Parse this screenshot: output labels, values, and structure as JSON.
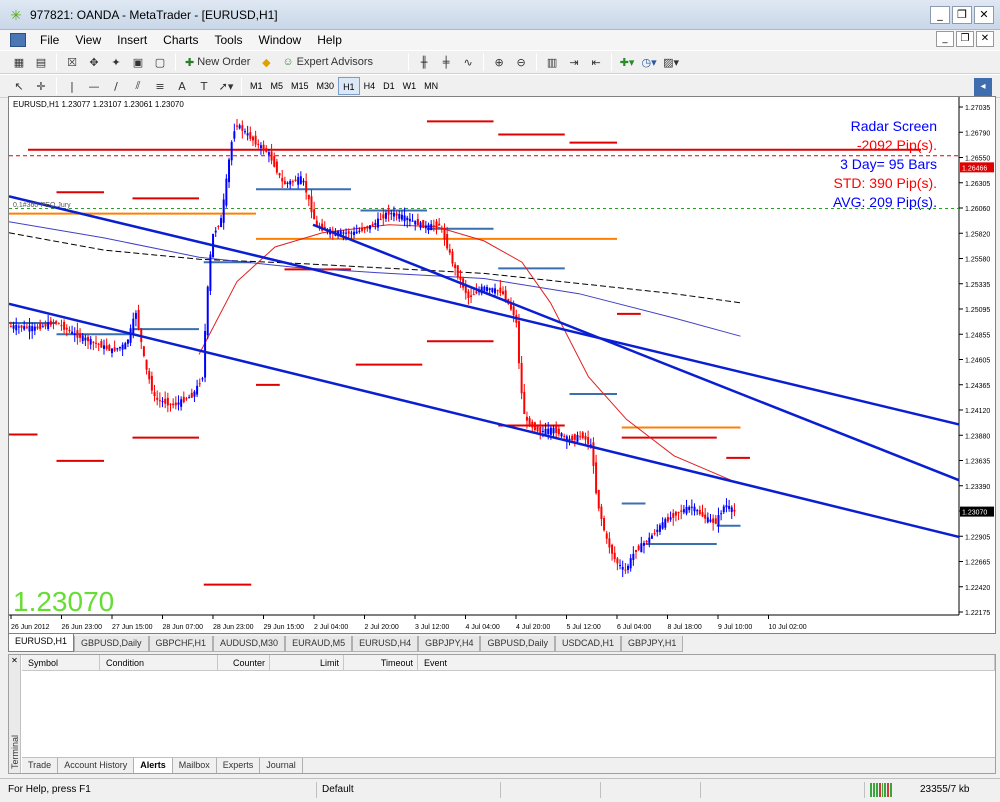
{
  "window": {
    "title": "977821: OANDA - MetaTrader - [EURUSD,H1]",
    "icon": "meta-trader-icon"
  },
  "menu": [
    "File",
    "View",
    "Insert",
    "Charts",
    "Tools",
    "Window",
    "Help"
  ],
  "toolbar": {
    "new_order": "New Order",
    "expert_advisors": "Expert Advisors",
    "timeframes": [
      "M1",
      "M5",
      "M15",
      "M30",
      "H1",
      "H4",
      "D1",
      "W1",
      "MN"
    ],
    "active_timeframe": "H1"
  },
  "chart": {
    "header": "EURUSD,H1  1.23077 1.23107 1.23061 1.23070",
    "indicator_label": "0,1#360-PEO Jury",
    "big_price": "1.23070",
    "current_price": "1.23070",
    "red_line_price": "1.26466",
    "radar": {
      "title": "Radar Screen",
      "pips": "-2092 Pip(s).",
      "bars": "3 Day= 95 Bars",
      "std": "STD: 390 Pip(s).",
      "avg": "AVG: 209 Pip(s)."
    },
    "colors": {
      "radar_blue": "#0000ff",
      "radar_red": "#ff0000",
      "price_green": "#66dd33",
      "bull_candle": "#0000ff",
      "bear_candle": "#ff0000"
    }
  },
  "chart_data": {
    "type": "candlestick",
    "symbol": "EURUSD",
    "timeframe": "H1",
    "y_ticks": [
      "1.27035",
      "1.26790",
      "1.26550",
      "1.26305",
      "1.26060",
      "1.25820",
      "1.25580",
      "1.25335",
      "1.25095",
      "1.24855",
      "1.24605",
      "1.24365",
      "1.24120",
      "1.23880",
      "1.23635",
      "1.23390",
      "1.23150",
      "1.22905",
      "1.22665",
      "1.22420",
      "1.22175"
    ],
    "x_ticks": [
      "26 Jun 2012",
      "26 Jun 23:00",
      "27 Jun 15:00",
      "28 Jun 07:00",
      "28 Jun 23:00",
      "29 Jun 15:00",
      "2 Jul 04:00",
      "2 Jul 20:00",
      "3 Jul 12:00",
      "4 Jul 04:00",
      "4 Jul 20:00",
      "5 Jul 12:00",
      "6 Jul 04:00",
      "8 Jul 18:00",
      "9 Jul 10:00",
      "10 Jul 02:00"
    ],
    "ylim": [
      1.2205,
      1.2716
    ],
    "price_path": [
      [
        0,
        1.249
      ],
      [
        0.03,
        1.2488
      ],
      [
        0.05,
        1.2494
      ],
      [
        0.07,
        1.2482
      ],
      [
        0.09,
        1.2474
      ],
      [
        0.11,
        1.2466
      ],
      [
        0.125,
        1.2472
      ],
      [
        0.135,
        1.2504
      ],
      [
        0.145,
        1.245
      ],
      [
        0.155,
        1.2418
      ],
      [
        0.175,
        1.2412
      ],
      [
        0.195,
        1.2422
      ],
      [
        0.205,
        1.244
      ],
      [
        0.21,
        1.252
      ],
      [
        0.215,
        1.2578
      ],
      [
        0.225,
        1.2596
      ],
      [
        0.235,
        1.2668
      ],
      [
        0.24,
        1.269
      ],
      [
        0.26,
        1.2672
      ],
      [
        0.275,
        1.266
      ],
      [
        0.29,
        1.263
      ],
      [
        0.31,
        1.2636
      ],
      [
        0.325,
        1.2588
      ],
      [
        0.345,
        1.2582
      ],
      [
        0.365,
        1.2582
      ],
      [
        0.385,
        1.259
      ],
      [
        0.4,
        1.2602
      ],
      [
        0.415,
        1.2598
      ],
      [
        0.44,
        1.2588
      ],
      [
        0.455,
        1.259
      ],
      [
        0.47,
        1.2548
      ],
      [
        0.485,
        1.2518
      ],
      [
        0.5,
        1.2528
      ],
      [
        0.52,
        1.2524
      ],
      [
        0.535,
        1.2498
      ],
      [
        0.54,
        1.243
      ],
      [
        0.545,
        1.2396
      ],
      [
        0.56,
        1.2386
      ],
      [
        0.575,
        1.2388
      ],
      [
        0.59,
        1.2378
      ],
      [
        0.605,
        1.2382
      ],
      [
        0.615,
        1.237
      ],
      [
        0.62,
        1.232
      ],
      [
        0.63,
        1.228
      ],
      [
        0.64,
        1.2258
      ],
      [
        0.65,
        1.2248
      ],
      [
        0.66,
        1.2268
      ],
      [
        0.675,
        1.228
      ],
      [
        0.69,
        1.2296
      ],
      [
        0.705,
        1.2306
      ],
      [
        0.72,
        1.2312
      ],
      [
        0.735,
        1.23
      ],
      [
        0.745,
        1.2296
      ],
      [
        0.755,
        1.2314
      ],
      [
        0.765,
        1.2307
      ]
    ],
    "levels": [
      {
        "color": "#e00000",
        "price": 1.2664,
        "x": [
          0.02,
          0.96
        ]
      },
      {
        "color": "#ff7f00",
        "price": 1.2601,
        "x": [
          0.0,
          0.26
        ]
      },
      {
        "color": "#ff7f00",
        "price": 1.2576,
        "x": [
          0.26,
          0.64
        ]
      },
      {
        "color": "#ff7f00",
        "price": 1.239,
        "x": [
          0.645,
          0.77
        ]
      },
      {
        "color": "#e00000",
        "price": 1.2692,
        "x": [
          0.44,
          0.51
        ]
      },
      {
        "color": "#e00000",
        "price": 1.2679,
        "x": [
          0.515,
          0.585
        ]
      },
      {
        "color": "#e00000",
        "price": 1.2671,
        "x": [
          0.59,
          0.64
        ]
      },
      {
        "color": "#e00000",
        "price": 1.2622,
        "x": [
          0.05,
          0.1
        ]
      },
      {
        "color": "#e00000",
        "price": 1.2616,
        "x": [
          0.13,
          0.2
        ]
      },
      {
        "color": "#e00000",
        "price": 1.2546,
        "x": [
          0.29,
          0.36
        ]
      },
      {
        "color": "#e00000",
        "price": 1.2502,
        "x": [
          0.64,
          0.665
        ]
      },
      {
        "color": "#e00000",
        "price": 1.2475,
        "x": [
          0.44,
          0.51
        ]
      },
      {
        "color": "#e00000",
        "price": 1.2452,
        "x": [
          0.365,
          0.435
        ]
      },
      {
        "color": "#e00000",
        "price": 1.2432,
        "x": [
          0.26,
          0.285
        ]
      },
      {
        "color": "#e00000",
        "price": 1.2392,
        "x": [
          0.515,
          0.585
        ]
      },
      {
        "color": "#e00000",
        "price": 1.238,
        "x": [
          0.645,
          0.745
        ]
      },
      {
        "color": "#e00000",
        "price": 1.2383,
        "x": [
          0.0,
          0.03
        ]
      },
      {
        "color": "#e00000",
        "price": 1.238,
        "x": [
          0.13,
          0.2
        ]
      },
      {
        "color": "#e00000",
        "price": 1.236,
        "x": [
          0.755,
          0.78
        ]
      },
      {
        "color": "#e00000",
        "price": 1.2357,
        "x": [
          0.05,
          0.1
        ]
      },
      {
        "color": "#e00000",
        "price": 1.2235,
        "x": [
          0.205,
          0.255
        ]
      },
      {
        "color": "#3a6fb0",
        "price": 1.2625,
        "x": [
          0.26,
          0.36
        ]
      },
      {
        "color": "#3a6fb0",
        "price": 1.2604,
        "x": [
          0.37,
          0.44
        ]
      },
      {
        "color": "#3a6fb0",
        "price": 1.2586,
        "x": [
          0.44,
          0.51
        ]
      },
      {
        "color": "#3a6fb0",
        "price": 1.2547,
        "x": [
          0.515,
          0.585
        ]
      },
      {
        "color": "#3a6fb0",
        "price": 1.2553,
        "x": [
          0.205,
          0.255
        ]
      },
      {
        "color": "#3a6fb0",
        "price": 1.2493,
        "x": [
          0.0,
          0.05
        ]
      },
      {
        "color": "#3a6fb0",
        "price": 1.2482,
        "x": [
          0.05,
          0.13
        ]
      },
      {
        "color": "#3a6fb0",
        "price": 1.2487,
        "x": [
          0.13,
          0.2
        ]
      },
      {
        "color": "#3a6fb0",
        "price": 1.2423,
        "x": [
          0.59,
          0.64
        ]
      },
      {
        "color": "#3a6fb0",
        "price": 1.2315,
        "x": [
          0.645,
          0.67
        ]
      },
      {
        "color": "#3a6fb0",
        "price": 1.2275,
        "x": [
          0.67,
          0.745
        ]
      },
      {
        "color": "#3a6fb0",
        "price": 1.2293,
        "x": [
          0.745,
          0.77
        ]
      }
    ],
    "channel_lines": [
      {
        "from": [
          0.0,
          1.2618
        ],
        "to": [
          1.0,
          1.2393
        ]
      },
      {
        "from": [
          0.0,
          1.2512
        ],
        "to": [
          1.0,
          1.2282
        ]
      },
      {
        "from": [
          0.32,
          1.259
        ],
        "to": [
          1.0,
          1.2338
        ]
      }
    ],
    "ma_red": [
      [
        0.2,
        1.2462
      ],
      [
        0.24,
        1.2534
      ],
      [
        0.28,
        1.2568
      ],
      [
        0.33,
        1.2582
      ],
      [
        0.4,
        1.259
      ],
      [
        0.45,
        1.2588
      ],
      [
        0.5,
        1.2574
      ],
      [
        0.54,
        1.2553
      ],
      [
        0.57,
        1.2513
      ],
      [
        0.61,
        1.244
      ],
      [
        0.65,
        1.2398
      ],
      [
        0.7,
        1.2362
      ],
      [
        0.76,
        1.2338
      ]
    ],
    "ma_blue": [
      [
        0.0,
        1.2593
      ],
      [
        0.1,
        1.2577
      ],
      [
        0.2,
        1.2558
      ],
      [
        0.3,
        1.2548
      ],
      [
        0.4,
        1.2542
      ],
      [
        0.5,
        1.2537
      ],
      [
        0.6,
        1.2522
      ],
      [
        0.7,
        1.2498
      ],
      [
        0.77,
        1.248
      ]
    ],
    "ma_black": [
      [
        0.0,
        1.2582
      ],
      [
        0.1,
        1.2565
      ],
      [
        0.2,
        1.2556
      ],
      [
        0.3,
        1.2552
      ],
      [
        0.4,
        1.2547
      ],
      [
        0.5,
        1.2542
      ],
      [
        0.6,
        1.2532
      ],
      [
        0.7,
        1.2522
      ],
      [
        0.77,
        1.2513
      ]
    ]
  },
  "chart_tabs": [
    "EURUSD,H1",
    "GBPUSD,Daily",
    "GBPCHF,H1",
    "AUDUSD,M30",
    "EURAUD,M5",
    "EURUSD,H4",
    "GBPJPY,H4",
    "GBPUSD,Daily",
    "USDCAD,H1",
    "GBPJPY,H1"
  ],
  "terminal": {
    "side_label": "Terminal",
    "columns": [
      "Symbol",
      "Condition",
      "Counter",
      "Limit",
      "Timeout",
      "Event"
    ],
    "tabs": [
      "Trade",
      "Account History",
      "Alerts",
      "Mailbox",
      "Experts",
      "Journal"
    ],
    "active_tab": "Alerts"
  },
  "status": {
    "help": "For Help, press F1",
    "profile": "Default",
    "traffic": "23355/7 kb"
  }
}
